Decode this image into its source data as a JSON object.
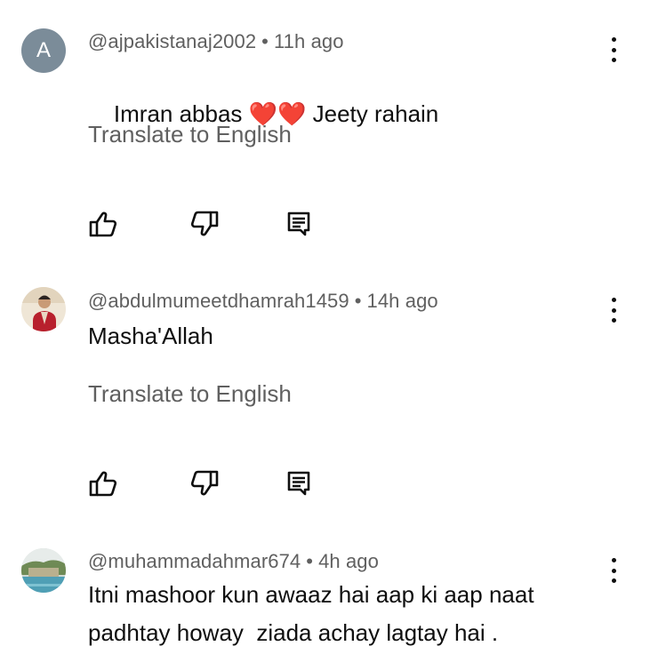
{
  "comments": [
    {
      "avatar_letter": "A",
      "avatar_color": "#7b8c99",
      "author": "@ajpakistanaj2002",
      "separator": "•",
      "time": "11h ago",
      "text_before": "Imran abbas ",
      "hearts": "❤️❤️",
      "text_after": " Jeety rahain",
      "translate_label": "Translate to English"
    },
    {
      "author": "@abdulmumeetdhamrah1459",
      "separator": "•",
      "time": "14h ago",
      "text": "Masha'Allah",
      "translate_label": "Translate to English"
    },
    {
      "author": "@muhammadahmar674",
      "separator": "•",
      "time": "4h ago",
      "text": "Itni mashoor kun awaaz hai aap ki aap naat padhtay howay  ziada achay lagtay hai ."
    }
  ],
  "icons": {
    "like": "thumbs-up-icon",
    "dislike": "thumbs-down-icon",
    "reply": "reply-comment-icon",
    "more": "more-vert-icon"
  }
}
